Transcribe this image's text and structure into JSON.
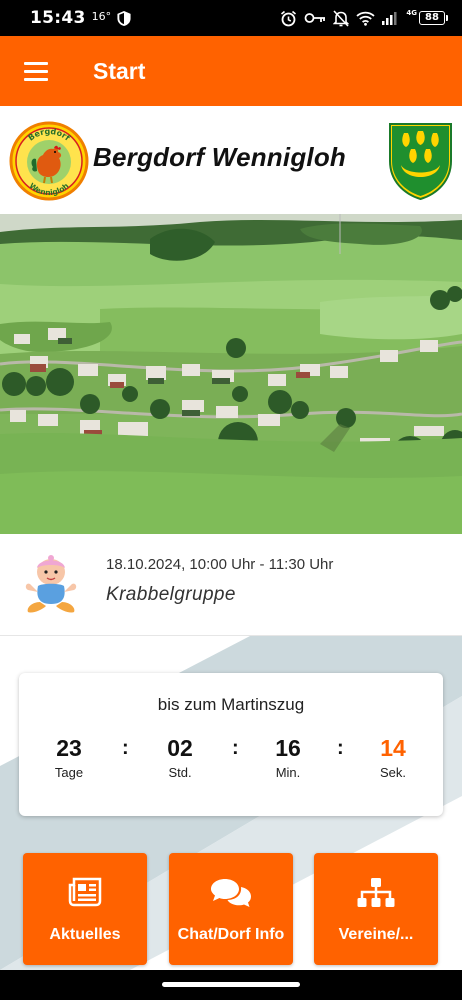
{
  "status_bar": {
    "time": "15:43",
    "temperature": "16°",
    "network": "4G",
    "battery": "88",
    "icons": [
      "shield-icon",
      "alarm-icon",
      "key-icon",
      "bell-off-icon",
      "wifi-icon",
      "signal-icon",
      "battery-icon"
    ]
  },
  "app_bar": {
    "menu_icon": "hamburger-menu-icon",
    "title": "Start",
    "color": "#ff6200"
  },
  "banner": {
    "title": "Bergdorf Wennigloh",
    "logo_text_top": "Bergdorf",
    "logo_text_bottom": "Wennigloh"
  },
  "event": {
    "date": "18.10.2024, 10:00 Uhr - 11:30 Uhr",
    "title": "Krabbelgruppe",
    "icon": "baby-icon"
  },
  "countdown": {
    "label": "bis zum Martinszug",
    "units": [
      {
        "value": "23",
        "name": "Tage"
      },
      {
        "value": "02",
        "name": "Std."
      },
      {
        "value": "16",
        "name": "Min."
      },
      {
        "value": "14",
        "name": "Sek."
      }
    ],
    "separator": ":",
    "accent_color": "#ff6200"
  },
  "tiles": [
    {
      "label": "Aktuelles",
      "icon": "newspaper-icon"
    },
    {
      "label": "Chat/Dorf Info",
      "icon": "chat-bubbles-icon"
    },
    {
      "label": "Vereine/...",
      "icon": "org-chart-icon"
    }
  ]
}
